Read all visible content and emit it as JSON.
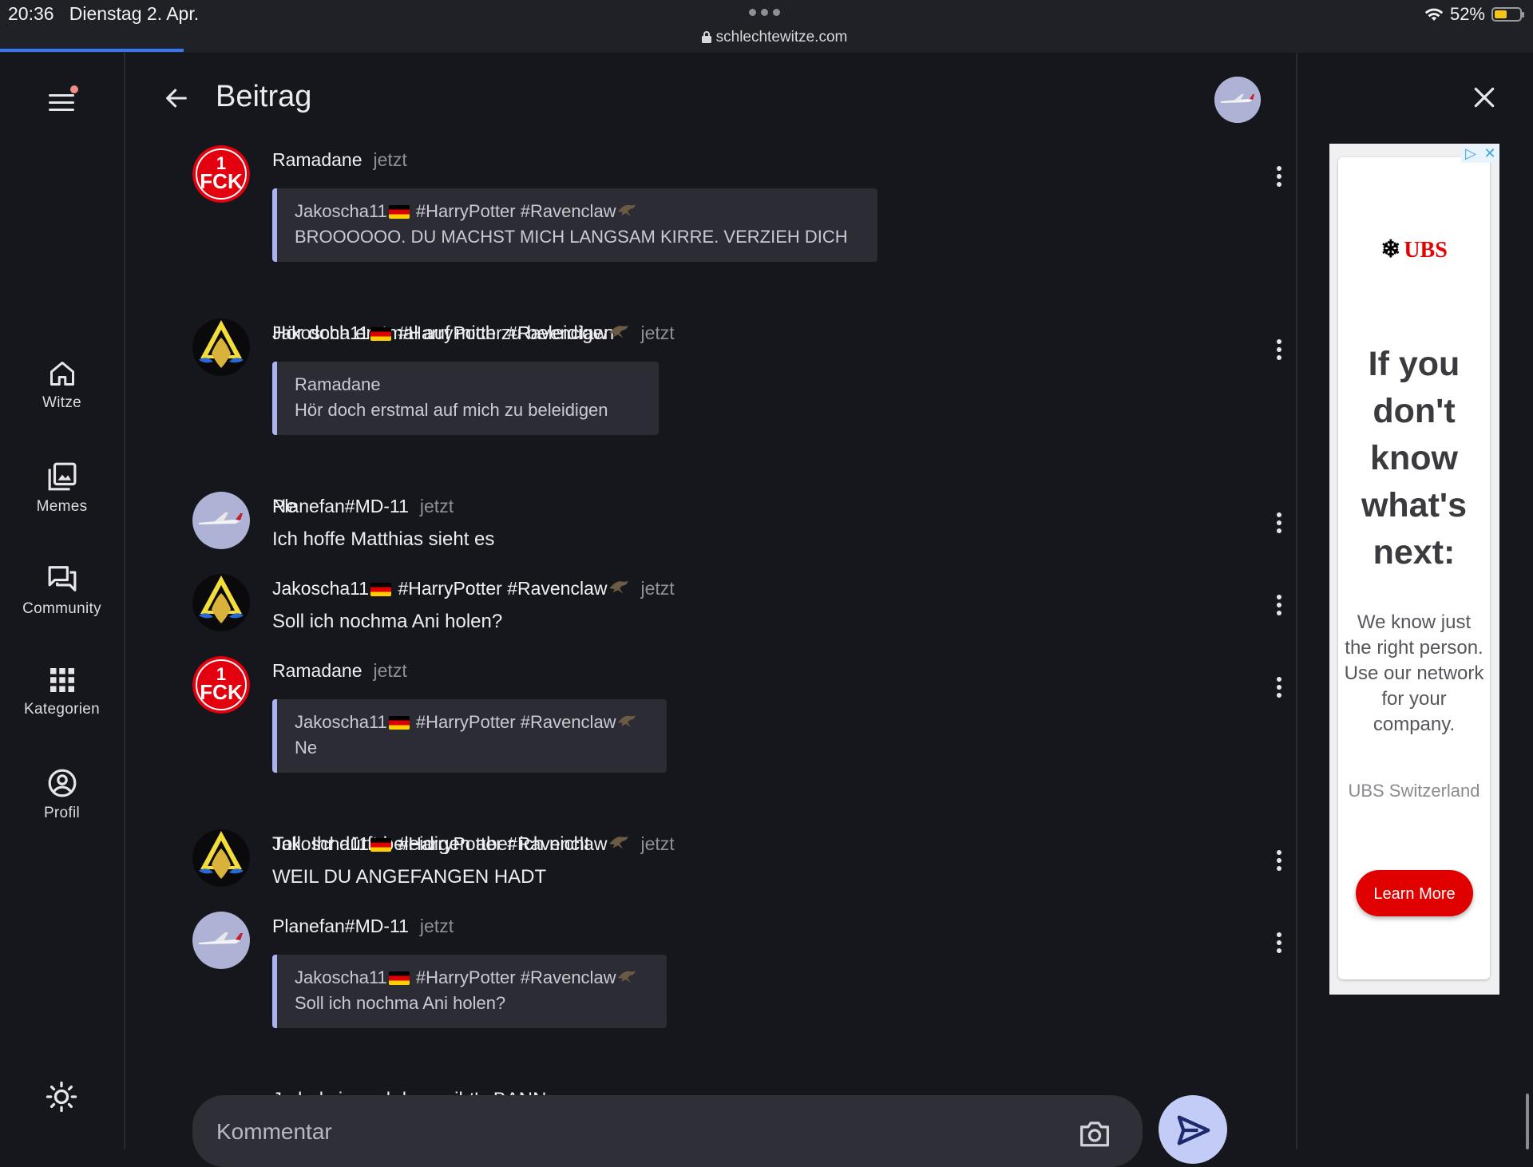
{
  "status_bar": {
    "time": "20:36",
    "date": "Dienstag 2. Apr.",
    "url": "schlechtewitze.com",
    "battery": "52%"
  },
  "nav": {
    "items": [
      {
        "label": "Witze"
      },
      {
        "label": "Memes"
      },
      {
        "label": "Community"
      },
      {
        "label": "Kategorien"
      },
      {
        "label": "Profil"
      }
    ]
  },
  "header": {
    "title": "Beitrag"
  },
  "comments": [
    {
      "author": "Ramadane",
      "time": "jetzt",
      "quote": {
        "author": "Jakoscha11",
        "author_tags": "#HarryPotter #Ravenclaw",
        "text": "BROOOOOO. DU MACHST MICH LANGSAM KIRRE. VERZIEH DICH"
      },
      "text": "Hör doch erstmal auf mich zu beleidigen"
    },
    {
      "author": "Jakoscha11",
      "author_tags": "#HarryPotter #Ravenclaw",
      "time": "jetzt",
      "quote": {
        "author": "Ramadane",
        "text": "Hör doch erstmal auf mich zu beleidigen"
      },
      "text": "Ne"
    },
    {
      "author": "Planefan#MD-11",
      "time": "jetzt",
      "text": "Ich hoffe Matthias sieht es"
    },
    {
      "author": "Jakoscha11",
      "author_tags": "#HarryPotter #Ravenclaw",
      "time": "jetzt",
      "text": "Soll ich nochma Ani holen?"
    },
    {
      "author": "Ramadane",
      "time": "jetzt",
      "quote": {
        "author": "Jakoscha11",
        "author_tags": "#HarryPotter #Ravenclaw",
        "text": "Ne"
      },
      "text": "Toll. Ihr dürft beleidigen aber ich nicht"
    },
    {
      "author": "Jakoscha11",
      "author_tags": "#HarryPotter #Ravenclaw",
      "time": "jetzt",
      "text": "WEIL DU ANGEFANGEN HADT"
    },
    {
      "author": "Planefan#MD-11",
      "time": "jetzt",
      "quote": {
        "author": "Jakoscha11",
        "author_tags": "#HarryPotter #Ravenclaw",
        "text": "Soll ich nochma Ani holen?"
      },
      "text": "Ja hol sie und dann gibt's BANN"
    }
  ],
  "comment_input": {
    "placeholder": "Kommentar"
  },
  "ad": {
    "brand": "UBS",
    "headline": "If you don't know what's next:",
    "body": "We know just the right person. Use our network for your company.",
    "source": "UBS Switzerland",
    "cta": "Learn More"
  },
  "colors": {
    "background": "#16171d",
    "quote_bar": "#aab3f0",
    "send_button": "#c3ccf6",
    "ad_cta": "#e00000",
    "notification_dot": "#f28b82"
  }
}
